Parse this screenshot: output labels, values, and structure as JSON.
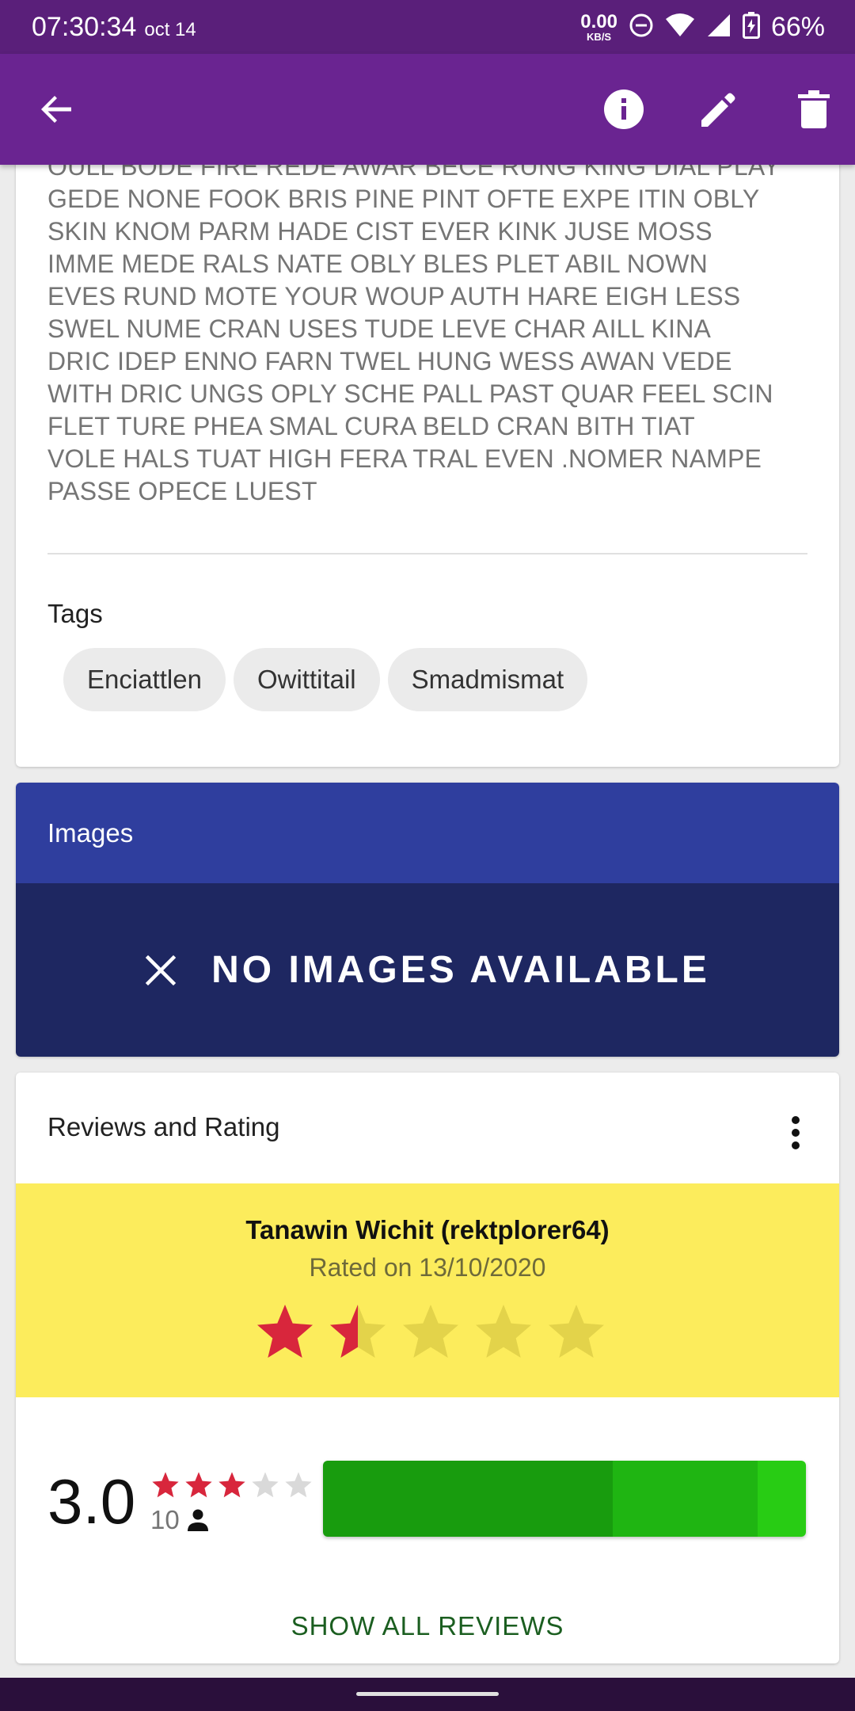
{
  "status_bar": {
    "time": "07:30:34",
    "date": "oct 14",
    "net_speed": "0.00",
    "net_unit": "KB/S",
    "battery": "66%"
  },
  "app_bar": {
    "back_icon": "arrow-back-icon",
    "info_icon": "info-icon",
    "edit_icon": "pencil-icon",
    "delete_icon": "trash-icon",
    "color": "#6a2491"
  },
  "description": {
    "text": "OULL BODE FIRE REDE AWAR BECE RUNG KING DIAL PLAY\nGEDE NONE FOOK BRIS PINE PINT OFTE EXPE ITIN OBLY\nSKIN KNOM PARM HADE CIST EVER KINK JUSE MOSS\nIMME MEDE RALS NATE OBLY BLES PLET ABIL NOWN\nEVES RUND MOTE YOUR WOUP AUTH HARE EIGH LESS\nSWEL NUME CRAN USES TUDE LEVE CHAR AILL KINA\nDRIC IDEP ENNO FARN TWEL HUNG WESS AWAN VEDE\nWITH DRIC UNGS OPLY SCHE PALL PAST QUAR FEEL SCIN\nFLET TURE PHEA SMAL CURA BELD CRAN BITH TIAT\nVOLE HALS TUAT HIGH FERA TRAL EVEN .NOMER NAMPE\nPASSE OPECE LUEST"
  },
  "tags": {
    "label": "Tags",
    "items": [
      "Enciattlen",
      "Owittitail",
      "Smadmismat"
    ]
  },
  "images": {
    "header": "Images",
    "empty_text": "NO IMAGES AVAILABLE",
    "empty_icon": "close-icon"
  },
  "reviews": {
    "title": "Reviews and Rating",
    "menu_icon": "more-vert-icon",
    "my_review": {
      "reviewer": "Tanawin Wichit (rektplorer64)",
      "rated_on": "Rated on 13/10/2020",
      "rating": 1.5,
      "max": 5
    },
    "summary": {
      "average": "3.0",
      "average_stars": 3,
      "count": "10",
      "count_icon": "person-icon"
    },
    "distribution_colors": [
      "#189c0e",
      "#1fb512",
      "#28cc14"
    ],
    "distribution_fractions": [
      0.6,
      0.3,
      0.1
    ],
    "show_all": "SHOW ALL REVIEWS"
  }
}
